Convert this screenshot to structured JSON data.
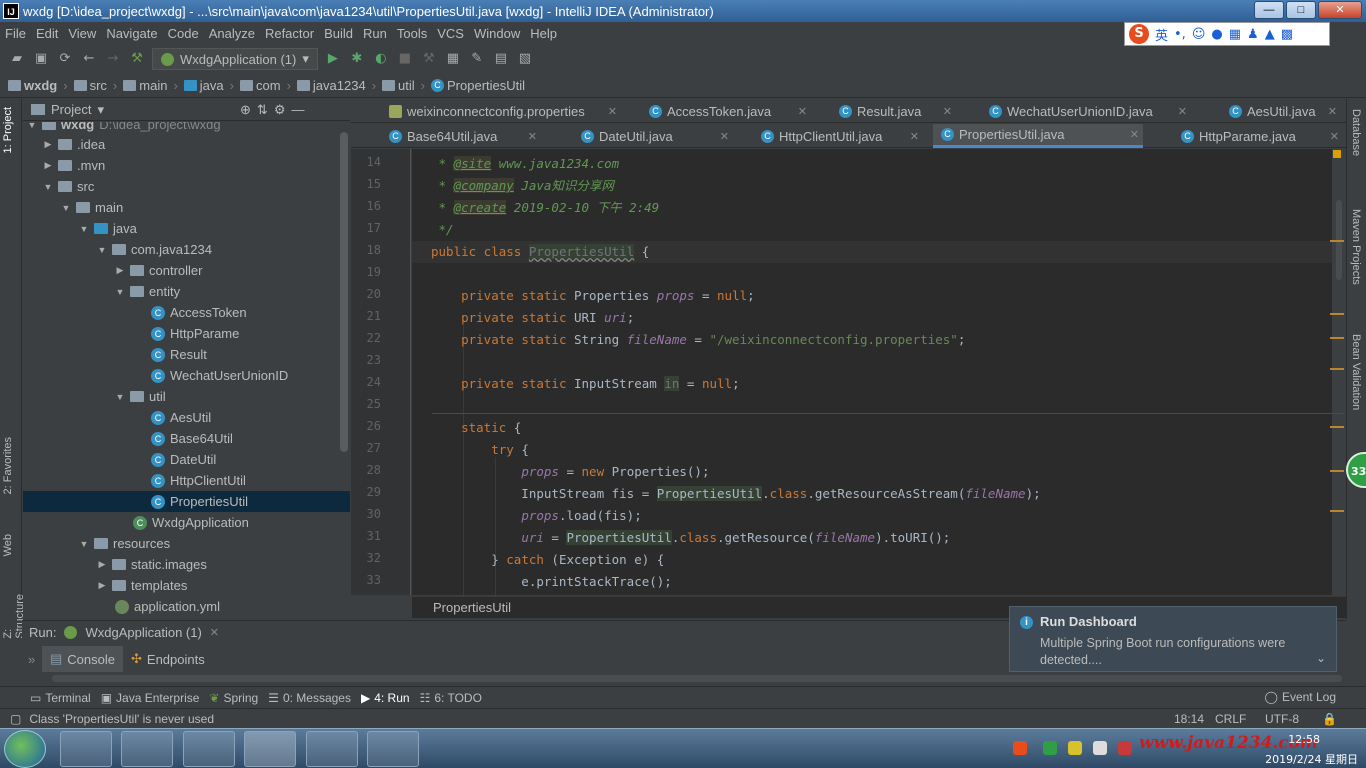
{
  "window": {
    "title": "wxdg [D:\\idea_project\\wxdg] - ...\\src\\main\\java\\com\\java1234\\util\\PropertiesUtil.java [wxdg] - IntelliJ IDEA (Administrator)",
    "logo": "IJ",
    "minimize": "—",
    "maximize": "□",
    "close": "✕"
  },
  "menu": [
    "File",
    "Edit",
    "View",
    "Navigate",
    "Code",
    "Analyze",
    "Refactor",
    "Build",
    "Run",
    "Tools",
    "VCS",
    "Window",
    "Help"
  ],
  "ime": {
    "logo": "S",
    "mode": "英"
  },
  "toolbar": {
    "run_config": "WxdgApplication (1)"
  },
  "breadcrumb": [
    "wxdg",
    "src",
    "main",
    "java",
    "com",
    "java1234",
    "util",
    "PropertiesUtil"
  ],
  "left_stripe": {
    "project": "1: Project",
    "favorites": "2: Favorites",
    "web": "Web",
    "structure": "Z: Structure"
  },
  "project_panel": {
    "title": "Project",
    "root_path": "D:\\idea_project\\wxdg",
    "tree": [
      {
        "label": "wxdg",
        "type": "folder"
      },
      {
        "label": ".idea",
        "type": "folder"
      },
      {
        "label": ".mvn",
        "type": "folder"
      },
      {
        "label": "src",
        "type": "folder"
      },
      {
        "label": "main",
        "type": "folder"
      },
      {
        "label": "java",
        "type": "folder"
      },
      {
        "label": "com.java1234",
        "type": "folder"
      },
      {
        "label": "controller",
        "type": "folder"
      },
      {
        "label": "entity",
        "type": "folder"
      },
      {
        "label": "AccessToken",
        "type": "class"
      },
      {
        "label": "HttpParame",
        "type": "class"
      },
      {
        "label": "Result",
        "type": "class"
      },
      {
        "label": "WechatUserUnionID",
        "type": "class"
      },
      {
        "label": "util",
        "type": "folder"
      },
      {
        "label": "AesUtil",
        "type": "class"
      },
      {
        "label": "Base64Util",
        "type": "class"
      },
      {
        "label": "DateUtil",
        "type": "class"
      },
      {
        "label": "HttpClientUtil",
        "type": "class"
      },
      {
        "label": "PropertiesUtil",
        "type": "class",
        "selected": true
      },
      {
        "label": "WxdgApplication",
        "type": "class"
      },
      {
        "label": "resources",
        "type": "folder"
      },
      {
        "label": "static.images",
        "type": "folder"
      },
      {
        "label": "templates",
        "type": "folder"
      },
      {
        "label": "application.yml",
        "type": "yml"
      }
    ]
  },
  "tabs_row1": [
    "weixinconnectconfig.properties",
    "AccessToken.java",
    "Result.java",
    "WechatUserUnionID.java",
    "AesUtil.java"
  ],
  "tabs_row2": [
    "Base64Util.java",
    "DateUtil.java",
    "HttpClientUtil.java",
    "PropertiesUtil.java",
    "HttpParame.java"
  ],
  "active_tab": "PropertiesUtil.java",
  "editor": {
    "line_numbers": [
      "14",
      "15",
      "16",
      "17",
      "18",
      "19",
      "20",
      "21",
      "22",
      "23",
      "24",
      "25",
      "26",
      "27",
      "28",
      "29",
      "30",
      "31",
      "32",
      "33"
    ],
    "file_crumb": "PropertiesUtil"
  },
  "right_stripe": {
    "database": "Database",
    "maven": "Maven Projects",
    "bean": "Bean Validation",
    "badge": "33"
  },
  "run_panel": {
    "label": "Run:",
    "config": "WxdgApplication (1)",
    "tabs": [
      "Console",
      "Endpoints"
    ]
  },
  "notification": {
    "title": "Run Dashboard",
    "body": "Multiple Spring Boot run configurations were detected....",
    "icon": "i"
  },
  "tool_tabs": {
    "terminal": "Terminal",
    "java_enterprise": "Java Enterprise",
    "spring": "Spring",
    "messages": "0: Messages",
    "run": "4: Run",
    "todo": "6: TODO",
    "event_log": "Event Log"
  },
  "status": {
    "message": "Class 'PropertiesUtil' is never used",
    "position": "18:14",
    "line_sep": "CRLF",
    "encoding": "UTF-8"
  },
  "taskbar": {
    "watermark": "www.java1234.com",
    "time": "12:58",
    "date": "2019/2/24 星期日"
  },
  "colors": {
    "keyword": "#cc7832",
    "string": "#6a8759",
    "comment": "#629755",
    "field": "#9876aa",
    "accent": "#4a88c7"
  }
}
